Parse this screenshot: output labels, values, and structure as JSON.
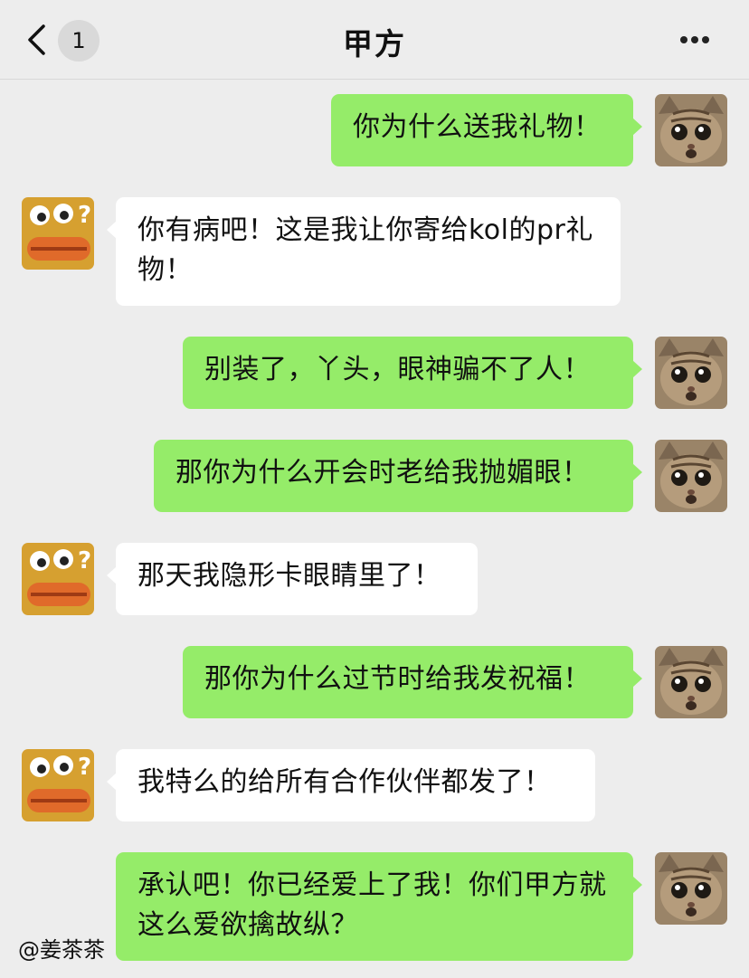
{
  "header": {
    "back_icon": "chevron-left-icon",
    "unread_count": "1",
    "title": "甲方",
    "more_icon": "more-dots-icon"
  },
  "messages": [
    {
      "side": "me",
      "text": "你为什么送我礼物！"
    },
    {
      "side": "them",
      "text": "你有病吧！这是我让你寄给kol的pr礼物！"
    },
    {
      "side": "me",
      "text": "别装了，丫头，眼神骗不了人！"
    },
    {
      "side": "me",
      "text": "那你为什么开会时老给我抛媚眼！"
    },
    {
      "side": "them",
      "text": "那天我隐形卡眼睛里了！"
    },
    {
      "side": "me",
      "text": "那你为什么过节时给我发祝福！"
    },
    {
      "side": "them",
      "text": "我特么的给所有合作伙伴都发了！"
    },
    {
      "side": "me",
      "text": "承认吧！你已经爱上了我！你们甲方就这么爱欲擒故纵？"
    }
  ],
  "watermark": "@姜茶茶",
  "colors": {
    "background": "#ededed",
    "my_bubble": "#95ec69",
    "their_bubble": "#ffffff"
  }
}
